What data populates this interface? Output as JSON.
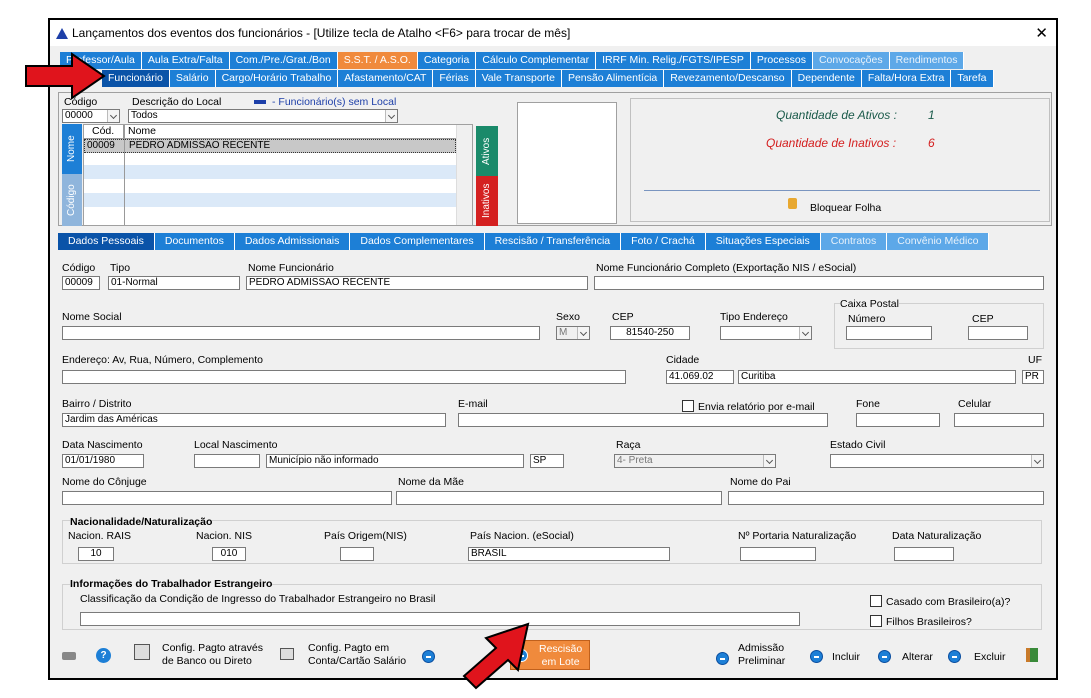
{
  "window": {
    "title": "Lançamentos dos eventos dos funcionários - [Utilize tecla de Atalho <F6> para trocar de mês]",
    "close": "✕"
  },
  "tabs_row1": [
    "Professor/Aula",
    "Aula Extra/Falta",
    "Com./Pre./Grat./Bon",
    "S.S.T. / A.S.O.",
    "Categoria",
    "Cálculo Complementar",
    "IRRF Min. Relig./FGTS/IPESP",
    "Processos",
    "Convocações",
    "Rendimentos"
  ],
  "tabs_row2": [
    "Funcionário",
    "Salário",
    "Cargo/Horário Trabalho",
    "Afastamento/CAT",
    "Férias",
    "Vale Transporte",
    "Pensão Alimentícia",
    "Revezamento/Descanso",
    "Dependente",
    "Falta/Hora Extra",
    "Tarefa"
  ],
  "top": {
    "codigo_label": "Código",
    "codigo_value": "00000",
    "desc_label": "Descrição do Local",
    "desc_value": "Todos",
    "legend": "- Funcionário(s) sem Local",
    "grid_headers": [
      "Cód.",
      "Nome"
    ],
    "grid_row": {
      "cod": "00009",
      "nome": "PEDRO ADMISSAO RECENTE"
    },
    "side_nome": "Nome",
    "side_codigo": "Código",
    "ativos": "Ativos",
    "inativos": "Inativos",
    "qtd_ativos_label": "Quantidade de Ativos :",
    "qtd_ativos": "1",
    "qtd_inativos_label": "Quantidade de Inativos :",
    "qtd_inativos": "6",
    "bloquear": "Bloquear Folha"
  },
  "tabs_row3": [
    "Dados Pessoais",
    "Documentos",
    "Dados Admissionais",
    "Dados Complementares",
    "Rescisão / Transferência",
    "Foto / Crachá",
    "Situações Especiais",
    "Contratos",
    "Convênio Médico"
  ],
  "form": {
    "codigo_l": "Código",
    "codigo": "00009",
    "tipo_l": "Tipo",
    "tipo": "01-Normal",
    "nome_l": "Nome Funcionário",
    "nome": "PEDRO ADMISSAO RECENTE",
    "nome_completo_l": "Nome Funcionário Completo (Exportação NIS / eSocial)",
    "nome_social_l": "Nome Social",
    "sexo_l": "Sexo",
    "sexo": "M",
    "cep_l": "CEP",
    "cep": "81540-250",
    "tipo_end_l": "Tipo Endereço",
    "caixa_postal_l": "Caixa Postal",
    "numero_l": "Número",
    "cep2_l": "CEP",
    "endereco_l": "Endereço: Av, Rua, Número, Complemento",
    "cidade_l": "Cidade",
    "cidade_cod": "41.069.02",
    "cidade": "Curitiba",
    "uf_l": "UF",
    "uf": "PR",
    "bairro_l": "Bairro / Distrito",
    "bairro": "Jardim das Américas",
    "email_l": "E-mail",
    "envia_l": "Envia relatório por e-mail",
    "fone_l": "Fone",
    "celular_l": "Celular",
    "nasc_l": "Data Nascimento",
    "nasc": "01/01/1980",
    "local_nasc_l": "Local Nascimento",
    "municipio": "Município não informado",
    "uf_nasc": "SP",
    "raca_l": "Raça",
    "raca": "4- Preta",
    "estado_civil_l": "Estado Civil",
    "conjuge_l": "Nome do Cônjuge",
    "mae_l": "Nome da Mãe",
    "pai_l": "Nome do Pai",
    "nac_title": "Nacionalidade/Naturalização",
    "nac_rais_l": "Nacion. RAIS",
    "nac_rais": "10",
    "nac_nis_l": "Nacion. NIS",
    "nac_nis": "010",
    "pais_origem_l": "País Origem(NIS)",
    "pais_nac_l": "País Nacion. (eSocial)",
    "pais_nac": "BRASIL",
    "portaria_l": "Nº Portaria Naturalização",
    "data_nat_l": "Data Naturalização",
    "estr_title": "Informações do Trabalhador Estrangeiro",
    "estr_class_l": "Classificação da Condição de Ingresso do Trabalhador Estrangeiro no Brasil",
    "casado_l": "Casado com Brasileiro(a)?",
    "filhos_l": "Filhos Brasileiros?"
  },
  "bottom": {
    "config1": "Config. Pagto através\nde Banco ou Direto",
    "config2": "Config. Pagto em\nConta/Cartão Salário",
    "rescisao": "Rescisão\nem Lote",
    "admissao": "Admissão\nPreliminar",
    "incluir": "Incluir",
    "alterar": "Alterar",
    "excluir": "Excluir"
  },
  "colors": {
    "tab": "#1d7fd6",
    "tab_sel": "#0a53a8",
    "orange": "#f08a3c",
    "ativos": "#1a8a6a",
    "inativos": "#d42020",
    "arrow": "#e0141c"
  }
}
